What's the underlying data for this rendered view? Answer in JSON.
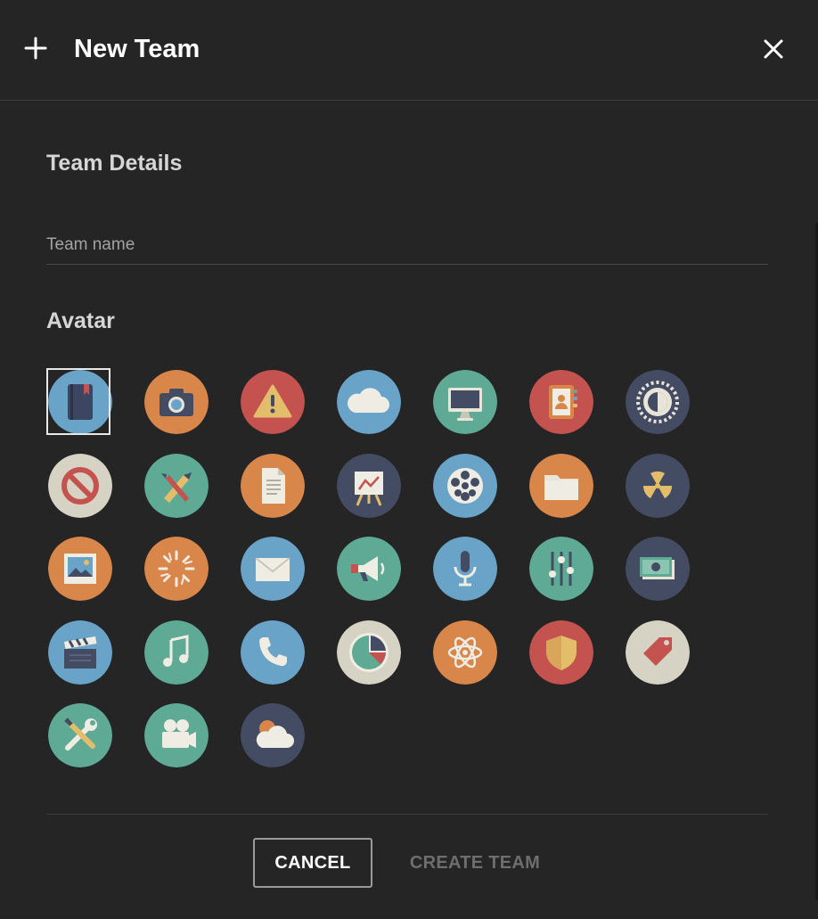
{
  "dialog": {
    "title": "New Team",
    "add_icon": "plus-icon",
    "close_icon": "close-icon"
  },
  "team_details": {
    "heading": "Team Details",
    "team_name": {
      "value": "",
      "placeholder": "Team name"
    }
  },
  "avatar_section": {
    "heading": "Avatar",
    "selected": "notebook-icon",
    "avatars": [
      {
        "icon": "notebook-icon",
        "color": "#6aa3c8"
      },
      {
        "icon": "camera-icon",
        "color": "#d9864a"
      },
      {
        "icon": "warning-icon",
        "color": "#c4524e"
      },
      {
        "icon": "cloud-icon",
        "color": "#6aa3c8"
      },
      {
        "icon": "monitor-icon",
        "color": "#5faa95"
      },
      {
        "icon": "address-book-icon",
        "color": "#c4524e"
      },
      {
        "icon": "contrast-gear-icon",
        "color": "#444c63"
      },
      {
        "icon": "prohibited-icon",
        "color": "#d6d3c4"
      },
      {
        "icon": "design-tools-icon",
        "color": "#5faa95"
      },
      {
        "icon": "document-icon",
        "color": "#d9864a"
      },
      {
        "icon": "presentation-easel-icon",
        "color": "#444c63"
      },
      {
        "icon": "film-reel-icon",
        "color": "#6aa3c8"
      },
      {
        "icon": "folder-icon",
        "color": "#d9864a"
      },
      {
        "icon": "radiation-icon",
        "color": "#444c63"
      },
      {
        "icon": "picture-icon",
        "color": "#d9864a"
      },
      {
        "icon": "loading-spinner-icon",
        "color": "#d9864a"
      },
      {
        "icon": "envelope-icon",
        "color": "#6aa3c8"
      },
      {
        "icon": "megaphone-icon",
        "color": "#5faa95"
      },
      {
        "icon": "microphone-icon",
        "color": "#6aa3c8"
      },
      {
        "icon": "equalizer-sliders-icon",
        "color": "#5faa95"
      },
      {
        "icon": "money-icon",
        "color": "#444c63"
      },
      {
        "icon": "clapperboard-icon",
        "color": "#6aa3c8"
      },
      {
        "icon": "music-note-icon",
        "color": "#5faa95"
      },
      {
        "icon": "phone-icon",
        "color": "#6aa3c8"
      },
      {
        "icon": "pie-chart-icon",
        "color": "#d6d3c4"
      },
      {
        "icon": "atom-icon",
        "color": "#d9864a"
      },
      {
        "icon": "shield-icon",
        "color": "#c4524e"
      },
      {
        "icon": "price-tag-icon",
        "color": "#d6d3c4"
      },
      {
        "icon": "wrench-screwdriver-icon",
        "color": "#5faa95"
      },
      {
        "icon": "video-camera-icon",
        "color": "#5faa95"
      },
      {
        "icon": "sun-cloud-icon",
        "color": "#444c63"
      }
    ]
  },
  "actions": {
    "cancel_label": "CANCEL",
    "create_label": "CREATE TEAM"
  },
  "colors": {
    "background": "#252525",
    "divider": "#3c3c3c",
    "disabled_text": "#6e6e6e"
  }
}
